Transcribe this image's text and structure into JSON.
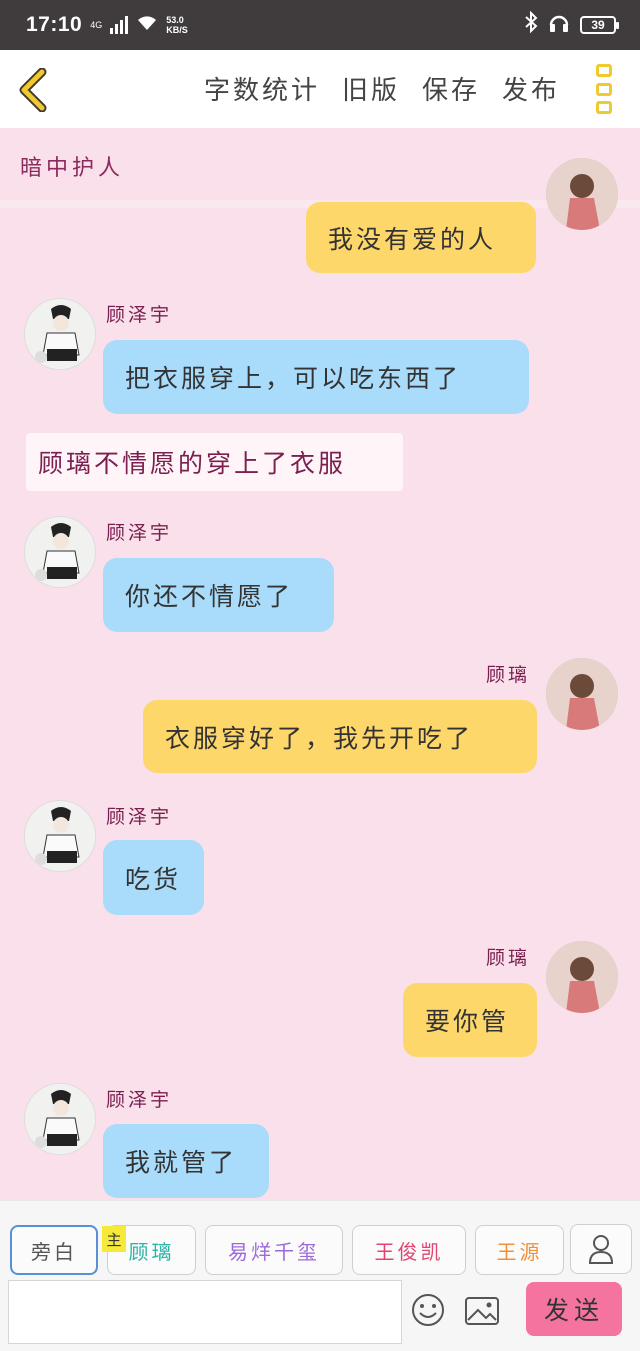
{
  "status_bar": {
    "time": "17:10",
    "network": "4G",
    "speed_value": "53.0",
    "speed_unit": "KB/S",
    "battery": "39"
  },
  "header": {
    "actions": [
      "字数统计",
      "旧版",
      "保存",
      "发布"
    ]
  },
  "chat": {
    "title": "暗中护人",
    "messages": [
      {
        "type": "self",
        "text": "我没有爱的人"
      },
      {
        "type": "other",
        "name": "顾泽宇",
        "text": "把衣服穿上，可以吃东西了"
      },
      {
        "type": "narration",
        "text": "顾璃不情愿的穿上了衣服"
      },
      {
        "type": "other",
        "name": "顾泽宇",
        "text": "你还不情愿了"
      },
      {
        "type": "self",
        "name": "顾璃",
        "text": "衣服穿好了，我先开吃了"
      },
      {
        "type": "other",
        "name": "顾泽宇",
        "text": "吃货"
      },
      {
        "type": "self",
        "name": "顾璃",
        "text": "要你管"
      },
      {
        "type": "other",
        "name": "顾泽宇",
        "text": "我就管了"
      }
    ]
  },
  "roles": {
    "narrator": "旁白",
    "main_badge": "主",
    "items": [
      "顾璃",
      "易烊千玺",
      "王俊凯",
      "王源"
    ],
    "colors": {
      "narrator": "#555555",
      "顾璃": "#2bb5a8",
      "易烊千玺": "#9b6ad8",
      "王俊凯": "#e0456f",
      "王源": "#f0913a"
    }
  },
  "input": {
    "placeholder": "",
    "send_label": "发送"
  },
  "colors": {
    "chat_bg": "#f9e0ea",
    "bubble_other": "#a9dcfa",
    "bubble_self": "#fed76b",
    "name_color": "#7a1f4f",
    "send_bg": "#f4749f"
  }
}
